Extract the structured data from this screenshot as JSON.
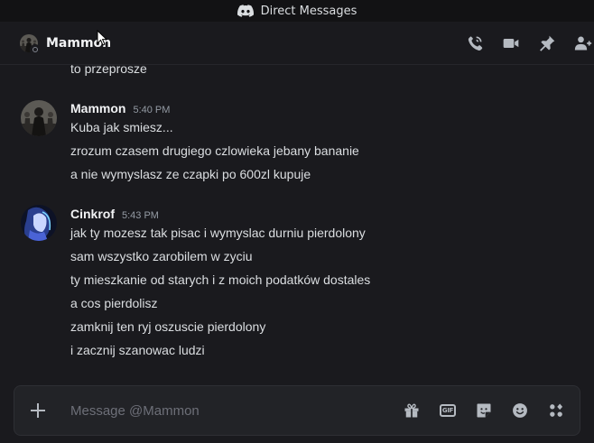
{
  "window": {
    "title": "Direct Messages"
  },
  "channel": {
    "name": "Mammon"
  },
  "header_actions": [
    {
      "icon": "voice-call-icon"
    },
    {
      "icon": "video-call-icon"
    },
    {
      "icon": "pin-icon"
    },
    {
      "icon": "add-friend-icon"
    }
  ],
  "messages": {
    "partial_line": "to przeprosze",
    "groups": [
      {
        "author": "Mammon",
        "time": "5:40 PM",
        "lines": [
          "Kuba jak smiesz...",
          "zrozum czasem drugiego czlowieka jebany bananie",
          "a nie wymyslasz ze czapki po 600zl kupuje"
        ]
      },
      {
        "author": "Cinkrof",
        "time": "5:43 PM",
        "lines": [
          "jak ty mozesz tak pisac i wymyslac durniu pierdolony",
          "sam wszystko zarobilem w zyciu",
          "ty mieszkanie od starych i z moich podatków dostales",
          "a cos pierdolisz",
          "zamknij ten ryj oszuscie pierdolony",
          "i zacznij szanowac ludzi"
        ]
      }
    ]
  },
  "composer": {
    "placeholder": "Message @Mammon",
    "value": "",
    "gif_label": "GIF"
  },
  "colors": {
    "background": "#1a1a1e",
    "titlebar": "#121214",
    "composer": "#222327",
    "text": "#dbdee1",
    "muted": "#949ba4"
  }
}
